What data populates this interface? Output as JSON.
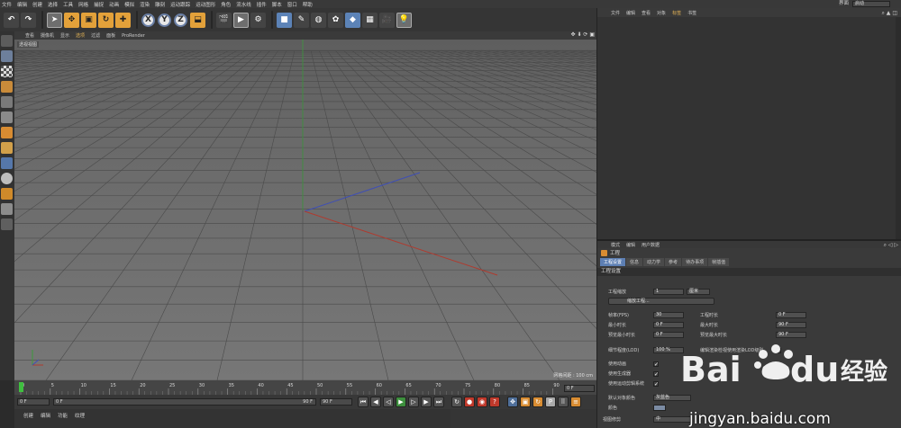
{
  "menubar": {
    "items": [
      "文件",
      "编辑",
      "创建",
      "选择",
      "工具",
      "网格",
      "捕捉",
      "动画",
      "模拟",
      "渲染",
      "雕刻",
      "运动跟踪",
      "运动图形",
      "角色",
      "流水线",
      "插件",
      "脚本",
      "窗口",
      "帮助"
    ],
    "layout_label": "界面",
    "layout_value": "启动"
  },
  "toolbar": {
    "axis_x": "X",
    "axis_y": "Y",
    "axis_z": "Z"
  },
  "viewport": {
    "menu": [
      "查看",
      "摄像机",
      "显示",
      "选项",
      "过滤",
      "面板",
      "ProRender"
    ],
    "label": "透视视图",
    "grid_distance": "网格间距 : 100 cm",
    "nav_icons": "✥ ⬇ ⟳ ▣"
  },
  "timeline": {
    "ticks": [
      "0",
      "5",
      "10",
      "15",
      "20",
      "25",
      "30",
      "35",
      "40",
      "45",
      "50",
      "55",
      "60",
      "65",
      "70",
      "75",
      "80",
      "85",
      "90"
    ],
    "end_frame": "0 F"
  },
  "transport": {
    "start": "0 F",
    "range_start": "0 F",
    "range_end": "90 F",
    "end": "90 F"
  },
  "material_bar": {
    "items": [
      "创建",
      "编辑",
      "功能",
      "纹理"
    ]
  },
  "object_manager": {
    "menu": [
      "文件",
      "编辑",
      "查看",
      "对象",
      "标签",
      "书签"
    ],
    "active_index": 4
  },
  "attribute_manager": {
    "menu": [
      "模式",
      "编辑",
      "用户数据"
    ],
    "title": "工程",
    "tabs": [
      "工程设置",
      "信息",
      "动力学",
      "参考",
      "待办事项",
      "帧插值"
    ],
    "section": "工程设置",
    "project_scale_label": "工程缩放",
    "project_scale_value": "1",
    "project_scale_unit": "厘米",
    "scale_button": "缩放工程...",
    "fps_label": "帧率(FPS)",
    "fps_value": "30",
    "min_time_label": "最小时长",
    "min_time_value": "0 F",
    "preview_min_label": "预览最小时长",
    "preview_min_value": "0 F",
    "project_time_label": "工程时长",
    "project_time_value": "0 F",
    "max_time_label": "最大时长",
    "max_time_value": "90 F",
    "preview_max_label": "预览最大时长",
    "preview_max_value": "90 F",
    "lod_label": "细节程度(LOD)",
    "lod_value": "100 %",
    "render_lod_label": "编辑渲染检视使用渲染LOD级别",
    "use_animation": "使用动画",
    "use_generators": "使用生成器",
    "use_motion_system": "使用运动剪辑系统",
    "default_color_label": "默认对象颜色",
    "default_color_value": "灰蓝色",
    "color_label": "颜色",
    "view_correction_label": "视图修剪",
    "view_correction_value": "中"
  },
  "watermark": {
    "url": "jingyan.baidu.com"
  },
  "colors": {
    "accent_blue": "#5c83b7",
    "accent_orange": "#e3a13a",
    "x_axis": "#b03a2e",
    "y_axis": "#3d9a3d",
    "z_axis": "#3f4fb5"
  }
}
